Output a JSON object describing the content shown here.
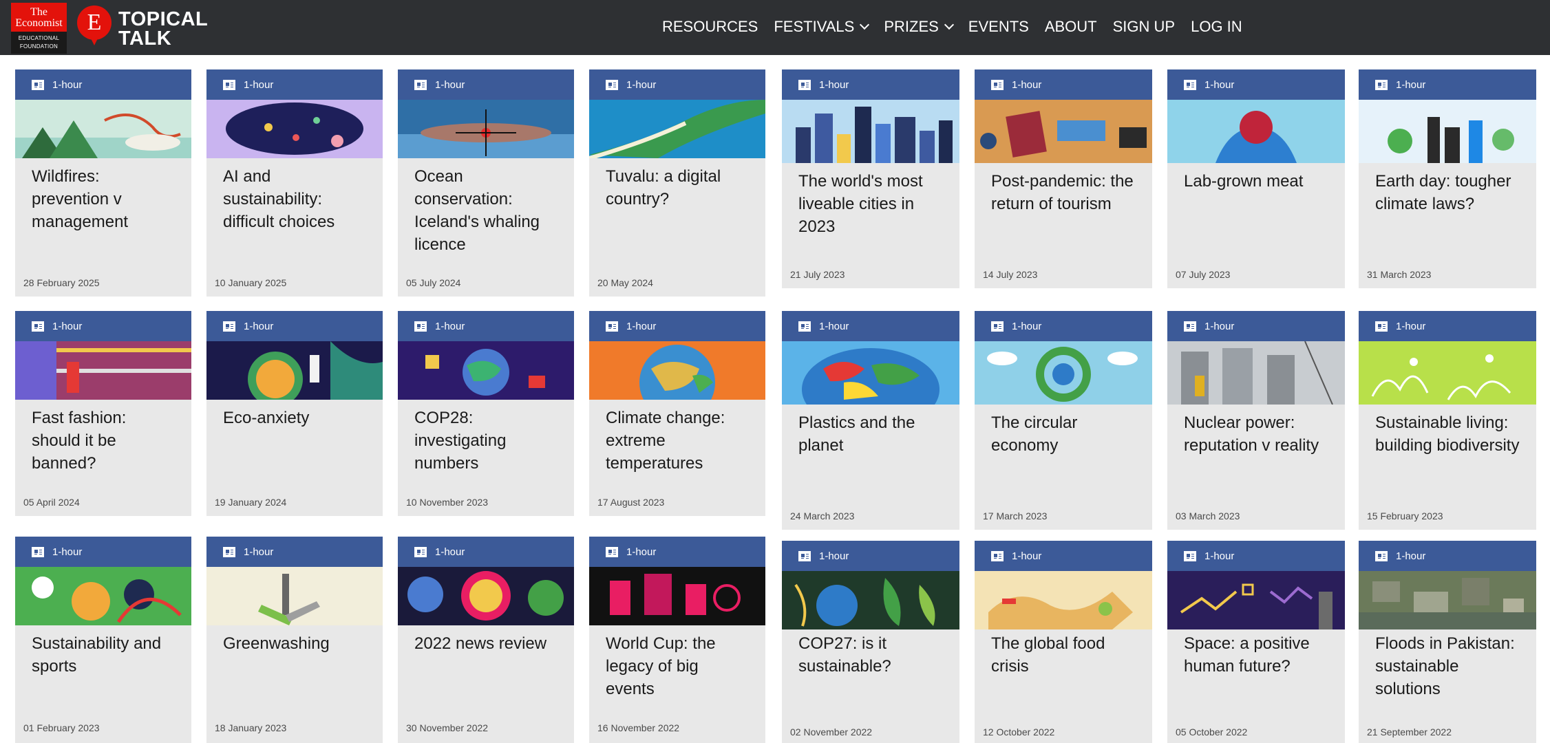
{
  "brand": {
    "economist_title": "The Economist",
    "economist_sub": "EDUCATIONAL FOUNDATION",
    "badge_letter": "E",
    "site_name_1": "TOPICAL",
    "site_name_2": "TALK"
  },
  "nav": {
    "items": [
      "RESOURCES",
      "FESTIVALS",
      "PRIZES",
      "EVENTS",
      "ABOUT",
      "SIGN UP",
      "LOG IN"
    ]
  },
  "cards": [
    {
      "duration": "1-hour",
      "title": "Wildfires: prevention v management",
      "date": "28 February 2025"
    },
    {
      "duration": "1-hour",
      "title": "AI and sustainability: difficult choices",
      "date": "10 January 2025"
    },
    {
      "duration": "1-hour",
      "title": "Ocean conservation: Iceland's whaling licence",
      "date": "05 July 2024"
    },
    {
      "duration": "1-hour",
      "title": "Tuvalu: a digital country?",
      "date": "20 May 2024"
    },
    {
      "duration": "1-hour",
      "title": "The world's most liveable cities in 2023",
      "date": "21 July 2023"
    },
    {
      "duration": "1-hour",
      "title": "Post-pandemic: the return of tourism",
      "date": "14 July 2023"
    },
    {
      "duration": "1-hour",
      "title": "Lab-grown meat",
      "date": "07 July 2023"
    },
    {
      "duration": "1-hour",
      "title": "Earth day: tougher climate laws?",
      "date": "31 March 2023"
    },
    {
      "duration": "1-hour",
      "title": "Fast fashion: should it be banned?",
      "date": "05 April 2024"
    },
    {
      "duration": "1-hour",
      "title": "Eco-anxiety",
      "date": "19 January 2024"
    },
    {
      "duration": "1-hour",
      "title": "COP28: investigating numbers",
      "date": "10 November 2023"
    },
    {
      "duration": "1-hour",
      "title": "Climate change: extreme temperatures",
      "date": "17 August 2023"
    },
    {
      "duration": "1-hour",
      "title": "Plastics and the planet",
      "date": "24 March 2023"
    },
    {
      "duration": "1-hour",
      "title": "The circular economy",
      "date": "17 March 2023"
    },
    {
      "duration": "1-hour",
      "title": "Nuclear power: reputation v reality",
      "date": "03 March 2023"
    },
    {
      "duration": "1-hour",
      "title": "Sustainable living: building biodiversity",
      "date": "15 February 2023"
    },
    {
      "duration": "1-hour",
      "title": "Sustainability and sports",
      "date": "01 February 2023"
    },
    {
      "duration": "1-hour",
      "title": "Greenwashing",
      "date": "18 January 2023"
    },
    {
      "duration": "1-hour",
      "title": "2022 news review",
      "date": "30 November 2022"
    },
    {
      "duration": "1-hour",
      "title": "World Cup: the legacy of big events",
      "date": "16 November 2022"
    },
    {
      "duration": "1-hour",
      "title": "COP27: is it sustainable?",
      "date": "02 November 2022"
    },
    {
      "duration": "1-hour",
      "title": "The global food crisis",
      "date": "12 October 2022"
    },
    {
      "duration": "1-hour",
      "title": "Space: a positive human future?",
      "date": "05 October 2022"
    },
    {
      "duration": "1-hour",
      "title": "Floods in Pakistan: sustainable solutions",
      "date": "21 September 2022"
    }
  ]
}
